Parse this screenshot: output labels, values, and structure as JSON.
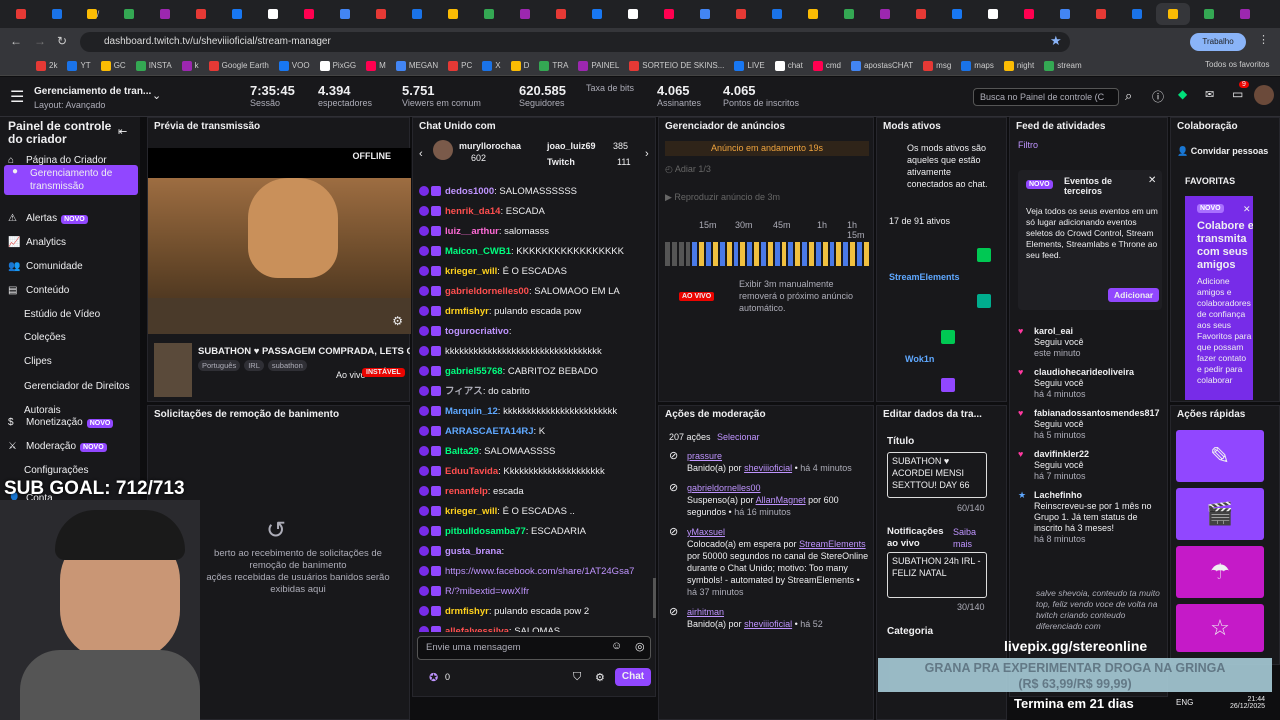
{
  "browser": {
    "url": "dashboard.twitch.tv/u/sheviiioficial/stream-manager",
    "profile": "Trabalho",
    "tabs": [
      "",
      "",
      "/",
      "",
      "",
      "",
      "",
      "",
      "",
      "",
      "",
      "",
      "",
      "",
      "",
      "",
      "",
      "",
      "",
      "",
      "",
      "",
      "",
      "",
      "",
      "",
      "",
      "",
      "",
      "",
      "",
      "",
      "",
      "",
      ""
    ],
    "bookmarks": [
      "2k",
      "YT",
      "GC",
      "INSTA",
      "k",
      "Google Earth",
      "VOO",
      "PixGG",
      "M",
      "MEGAN",
      "PC",
      "X",
      "D",
      "TRA",
      "PAINEL",
      "SORTEIO DE SKINS...",
      "LIVE",
      "chat",
      "cmd",
      "apostasCHAT",
      "msg",
      "maps",
      "night",
      "stream"
    ],
    "bookmarks_all": "Todos os favoritos"
  },
  "topbar": {
    "title": "Gerenciamento de tran...",
    "subtitle": "Layout: Avançado",
    "stats": [
      {
        "value": "7:35:45",
        "label": "Sessão"
      },
      {
        "value": "4.394",
        "label": "espectadores"
      },
      {
        "value": "5.751",
        "label": "Viewers em comum"
      },
      {
        "value": "620.585",
        "label": "Seguidores"
      },
      {
        "value": "",
        "label": "Taxa de bits"
      },
      {
        "value": "4.065",
        "label": "Assinantes"
      },
      {
        "value": "4.065",
        "label": "Pontos de inscritos"
      }
    ],
    "search_placeholder": "Busca no Painel de controle (C",
    "notif_count": "9"
  },
  "sidebar": {
    "title": "Painel de controle do criador",
    "items": [
      "Página do Criador",
      "Gerenciamento de transmissão",
      "Alertas",
      "Analytics",
      "Comunidade",
      "Conteúdo",
      "Estúdio de Vídeo",
      "Coleções",
      "Clipes",
      "Gerenciador de Direitos Autorais",
      "Monetização",
      "Moderação",
      "Configurações",
      "Conta"
    ],
    "novo": "NOVO"
  },
  "preview": {
    "header": "Prévia de transmissão",
    "offline": "OFFLINE",
    "title": "SUBATHON ♥ PASSAGEM COMPRADA, LETS GO",
    "tags": [
      "Português",
      "IRL",
      "subathon"
    ],
    "status": "Ao vivo",
    "unstable": "INSTÁVEL"
  },
  "ban_requests": {
    "header": "Solicitações de remoção de banimento",
    "line1": "berto ao recebimento de solicitações de",
    "line2": "remoção de banimento",
    "line3": "ações recebidas de usuários banidos serão",
    "line4": "exibidas aqui"
  },
  "overlay": {
    "sub_goal": "SUB GOAL: 712/713",
    "livepix": "livepix.gg/stereonline",
    "banner1": "GRANA PRA EXPERIMENTAR DROGA NA GRINGA",
    "banner2": "(R$ 63,99/R$ 99,99)",
    "ends": "Termina em 21 dias"
  },
  "chat": {
    "header": "Chat Unido com",
    "users": [
      {
        "name": "muryllorochaa",
        "count": "602"
      },
      {
        "name": "joao_luiz69",
        "count": "385"
      },
      {
        "name": "Twitch",
        "count": "111"
      }
    ],
    "messages": [
      {
        "user": "dedos1000",
        "color": "#bf94ff",
        "text": "SALOMASSSSSS"
      },
      {
        "user": "henrik_da14",
        "color": "#ff4f4f",
        "text": "ESCADA"
      },
      {
        "user": "luiz__arthur",
        "color": "#ff6bd6",
        "text": "salomasss"
      },
      {
        "user": "Maicon_CWB1",
        "color": "#00ff7f",
        "text": "KKKKKKKKKKKKKKKKK"
      },
      {
        "user": "krieger_will",
        "color": "#ffd21e",
        "text": "É O ESCADAS"
      },
      {
        "user": "gabrieldornelles00",
        "color": "#ff4f4f",
        "text": "SALOMAOO EM LA"
      },
      {
        "user": "drmfishyr",
        "color": "#ffd21e",
        "text": "pulando escada pow"
      },
      {
        "user": "togurocriativo",
        "color": "#bf94ff",
        "text": ""
      },
      {
        "user": "",
        "color": "#efeff1",
        "text": "kkkkkkkkkkkkkkkkkkkkkkkkkkkkkkkkk"
      },
      {
        "user": "gabriel55768",
        "color": "#00ff7f",
        "text": "CABRITOZ BEBADO"
      },
      {
        "user": "フィアス",
        "color": "#adadb8",
        "text": "do cabrito"
      },
      {
        "user": "Marquin_12",
        "color": "#5fa8ff",
        "text": "kkkkkkkkkkkkkkkkkkkkkkkk"
      },
      {
        "user": "ARRASCAETA14RJ",
        "color": "#5fa8ff",
        "text": "K"
      },
      {
        "user": "Balta29",
        "color": "#00ff7f",
        "text": "SALOMAASSSS"
      },
      {
        "user": "EduuTavida",
        "color": "#ff4f4f",
        "text": "Kkkkkkkkkkkkkkkkkkkkk"
      },
      {
        "user": "renanfelp",
        "color": "#ff4f4f",
        "text": "escada"
      },
      {
        "user": "krieger_will",
        "color": "#ffd21e",
        "text": "É O ESCADAS .."
      },
      {
        "user": "pitbulldosamba77",
        "color": "#00ff7f",
        "text": "ESCADARIA"
      },
      {
        "user": "gusta_brana",
        "color": "#bf94ff",
        "text": ""
      },
      {
        "user": "",
        "color": "#bf94ff",
        "text": "https://www.facebook.com/share/1AT24Gsa7"
      },
      {
        "user": "",
        "color": "#bf94ff",
        "text": "R/?mibextid=wwXIfr"
      },
      {
        "user": "drmfishyr",
        "color": "#ffd21e",
        "text": "pulando escada pow 2"
      },
      {
        "user": "allefalvessilva",
        "color": "#ff4f4f",
        "text": "SALOMAS"
      }
    ],
    "input_placeholder": "Envie uma mensagem",
    "points": "0",
    "send": "Chat"
  },
  "ads": {
    "header": "Gerenciador de anúncios",
    "running": "Anúncio em andamento",
    "running_time": "19s",
    "delay": "Adiar 1/3",
    "play": "Reproduzir anúncio de 3m",
    "ticks": [
      "15m",
      "30m",
      "45m",
      "1h",
      "1h 15m"
    ],
    "live": "AO VIVO",
    "note": "Exibir 3m manualmente removerá o próximo anúncio automático."
  },
  "mods": {
    "header": "Mods ativos",
    "desc": "Os mods ativos são aqueles que estão ativamente conectados ao chat.",
    "count": "17 de 91 ativos",
    "names": [
      "StreamElements",
      "Wok1n"
    ]
  },
  "activity": {
    "header": "Feed de atividades",
    "filter": "Filtro",
    "novo": "NOVO",
    "card_title": "Eventos de terceiros",
    "card_text": "Veja todos os seus eventos em um só lugar adicionando eventos seletos do Crowd Control, Stream Elements, Streamlabs e Throne ao seu feed.",
    "add": "Adicionar",
    "events": [
      {
        "user": "karol_eai",
        "action": "Seguiu você",
        "time": "este minuto"
      },
      {
        "user": "claudiohecarideoliveira",
        "action": "Seguiu você",
        "time": "há 4 minutos"
      },
      {
        "user": "fabianadossantosmendes817",
        "action": "Seguiu você",
        "time": "há 5 minutos"
      },
      {
        "user": "davifinkler22",
        "action": "Seguiu você",
        "time": "há 7 minutos"
      },
      {
        "user": "Lachefinho",
        "action": "Reinscreveu-se por 1 mês no Grupo 1. Já tem status de inscrito há 3 meses!",
        "time": "há 8 minutos"
      }
    ],
    "last_msg": "salve shevoia, conteudo ta muito top, feliz vendo voce de volta na twitch criando conteudo diferenciado com"
  },
  "collab": {
    "header": "Colaboração",
    "invite": "Convidar pessoas",
    "favorites": "FAVORITAS",
    "novo": "NOVO",
    "card_title": "Colabore e transmita com seus amigos",
    "card_text": "Adicione amigos e colaboradores de confiança aos seus Favoritos para que possam fazer contato e pedir para colaborar"
  },
  "quick": {
    "header": "Ações rápidas"
  },
  "modactions": {
    "header": "Ações de moderação",
    "count": "207 ações",
    "select": "Selecionar",
    "items": [
      {
        "user": "prassure",
        "text": "Banido(a) por",
        "by": "sheviiioficial",
        "time": "há 4 minutos"
      },
      {
        "user": "gabrieldornelles00",
        "text": "Suspenso(a) por",
        "by": "AllanMagnet",
        "extra": "por 600 segundos",
        "time": "há 16 minutos"
      },
      {
        "user": "yMaxsuel",
        "text": "Colocado(a) em espera por",
        "by": "StreamElements",
        "extra": "por 50000 segundos no canal de StereOnline durante o Chat Unido; motivo: Too many symbols! - automated by StreamElements",
        "time": "há 37 minutos"
      },
      {
        "user": "airhitman",
        "text": "Banido(a) por",
        "by": "sheviiioficial",
        "time": "há 52"
      }
    ]
  },
  "edit": {
    "header": "Editar dados da tra...",
    "title_label": "Título",
    "title_value": "SUBATHON ♥ ACORDEI MENSI SEXTTOU! DAY 66",
    "title_count": "60/140",
    "notif_label": "Notificações ao vivo",
    "learn": "Saiba mais",
    "notif_value": "SUBATHON 24h IRL - FELIZ NATAL",
    "notif_count": "30/140",
    "category": "Categoria"
  },
  "taskbar": {
    "lang": "ENG",
    "time": "21:44",
    "date": "26/12/2025"
  }
}
